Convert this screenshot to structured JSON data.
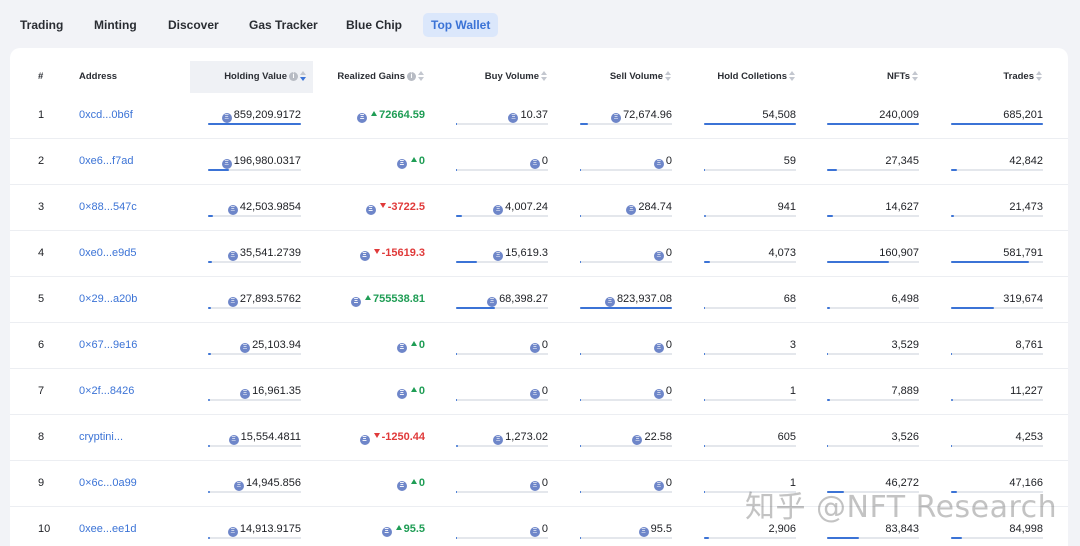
{
  "nav": {
    "tabs": [
      {
        "label": "Trading",
        "active": false
      },
      {
        "label": "Minting",
        "active": false
      },
      {
        "label": "Discover",
        "active": false
      },
      {
        "label": "Gas Tracker",
        "active": false
      },
      {
        "label": "Blue Chip",
        "active": false
      },
      {
        "label": "Top Wallet",
        "active": true
      }
    ]
  },
  "table": {
    "headers": {
      "rank": "#",
      "address": "Address",
      "holding_value": "Holding Value",
      "realized_gains": "Realized Gains",
      "buy_volume": "Buy Volume",
      "sell_volume": "Sell Volume",
      "hold_collections": "Hold Colletions",
      "nfts": "NFTs",
      "trades": "Trades"
    },
    "rows": [
      {
        "rank": "1",
        "address": "0xcd...0b6f",
        "holding_value": "859,209.9172",
        "hv_bar": 1.0,
        "realized_gains": "72664.59",
        "gain_dir": "up",
        "buy_volume": "10.37",
        "bv_bar": 0.01,
        "sell_volume": "72,674.96",
        "sv_bar": 0.09,
        "hold_collections": "54,508",
        "hc_bar": 1.0,
        "nfts": "240,009",
        "nft_bar": 1.0,
        "trades": "685,201",
        "tr_bar": 1.0
      },
      {
        "rank": "2",
        "address": "0xe6...f7ad",
        "holding_value": "196,980.0317",
        "hv_bar": 0.23,
        "realized_gains": "0",
        "gain_dir": "up",
        "buy_volume": "0",
        "bv_bar": 0.0,
        "sell_volume": "0",
        "sv_bar": 0.0,
        "hold_collections": "59",
        "hc_bar": 0.0,
        "nfts": "27,345",
        "nft_bar": 0.11,
        "trades": "42,842",
        "tr_bar": 0.06
      },
      {
        "rank": "3",
        "address": "0×88...547c",
        "holding_value": "42,503.9854",
        "hv_bar": 0.05,
        "realized_gains": "-3722.5",
        "gain_dir": "down",
        "buy_volume": "4,007.24",
        "bv_bar": 0.06,
        "sell_volume": "284.74",
        "sv_bar": 0.0,
        "hold_collections": "941",
        "hc_bar": 0.02,
        "nfts": "14,627",
        "nft_bar": 0.06,
        "trades": "21,473",
        "tr_bar": 0.03
      },
      {
        "rank": "4",
        "address": "0xe0...e9d5",
        "holding_value": "35,541.2739",
        "hv_bar": 0.04,
        "realized_gains": "-15619.3",
        "gain_dir": "down",
        "buy_volume": "15,619.3",
        "bv_bar": 0.23,
        "sell_volume": "0",
        "sv_bar": 0.0,
        "hold_collections": "4,073",
        "hc_bar": 0.07,
        "nfts": "160,907",
        "nft_bar": 0.67,
        "trades": "581,791",
        "tr_bar": 0.85
      },
      {
        "rank": "5",
        "address": "0×29...a20b",
        "holding_value": "27,893.5762",
        "hv_bar": 0.03,
        "realized_gains": "755538.81",
        "gain_dir": "up",
        "buy_volume": "68,398.27",
        "bv_bar": 0.42,
        "sell_volume": "823,937.08",
        "sv_bar": 1.0,
        "hold_collections": "68",
        "hc_bar": 0.0,
        "nfts": "6,498",
        "nft_bar": 0.03,
        "trades": "319,674",
        "tr_bar": 0.47
      },
      {
        "rank": "6",
        "address": "0×67...9e16",
        "holding_value": "25,103.94",
        "hv_bar": 0.03,
        "realized_gains": "0",
        "gain_dir": "up",
        "buy_volume": "0",
        "bv_bar": 0.0,
        "sell_volume": "0",
        "sv_bar": 0.0,
        "hold_collections": "3",
        "hc_bar": 0.0,
        "nfts": "3,529",
        "nft_bar": 0.01,
        "trades": "8,761",
        "tr_bar": 0.01
      },
      {
        "rank": "7",
        "address": "0×2f...8426",
        "holding_value": "16,961.35",
        "hv_bar": 0.02,
        "realized_gains": "0",
        "gain_dir": "up",
        "buy_volume": "0",
        "bv_bar": 0.0,
        "sell_volume": "0",
        "sv_bar": 0.0,
        "hold_collections": "1",
        "hc_bar": 0.0,
        "nfts": "7,889",
        "nft_bar": 0.03,
        "trades": "11,227",
        "tr_bar": 0.02
      },
      {
        "rank": "8",
        "address": "cryptini...",
        "holding_value": "15,554.4811",
        "hv_bar": 0.02,
        "realized_gains": "-1250.44",
        "gain_dir": "down",
        "buy_volume": "1,273.02",
        "bv_bar": 0.02,
        "sell_volume": "22.58",
        "sv_bar": 0.0,
        "hold_collections": "605",
        "hc_bar": 0.01,
        "nfts": "3,526",
        "nft_bar": 0.01,
        "trades": "4,253",
        "tr_bar": 0.01
      },
      {
        "rank": "9",
        "address": "0×6c...0a99",
        "holding_value": "14,945.856",
        "hv_bar": 0.02,
        "realized_gains": "0",
        "gain_dir": "up",
        "buy_volume": "0",
        "bv_bar": 0.0,
        "sell_volume": "0",
        "sv_bar": 0.0,
        "hold_collections": "1",
        "hc_bar": 0.0,
        "nfts": "46,272",
        "nft_bar": 0.19,
        "trades": "47,166",
        "tr_bar": 0.07
      },
      {
        "rank": "10",
        "address": "0xee...ee1d",
        "holding_value": "14,913.9175",
        "hv_bar": 0.02,
        "realized_gains": "95.5",
        "gain_dir": "up",
        "buy_volume": "0",
        "bv_bar": 0.0,
        "sell_volume": "95.5",
        "sv_bar": 0.0,
        "hold_collections": "2,906",
        "hc_bar": 0.05,
        "nfts": "83,843",
        "nft_bar": 0.35,
        "trades": "84,998",
        "tr_bar": 0.12
      }
    ]
  },
  "watermark": "知乎 @NFT Research",
  "colors": {
    "accent": "#3b73d6",
    "gain_up": "#1f9d55",
    "gain_down": "#e03a3a",
    "eth_icon": "#6e86c9"
  },
  "icons": {
    "currency": "eth-icon",
    "info": "info-icon",
    "sort": "sort-icon"
  }
}
